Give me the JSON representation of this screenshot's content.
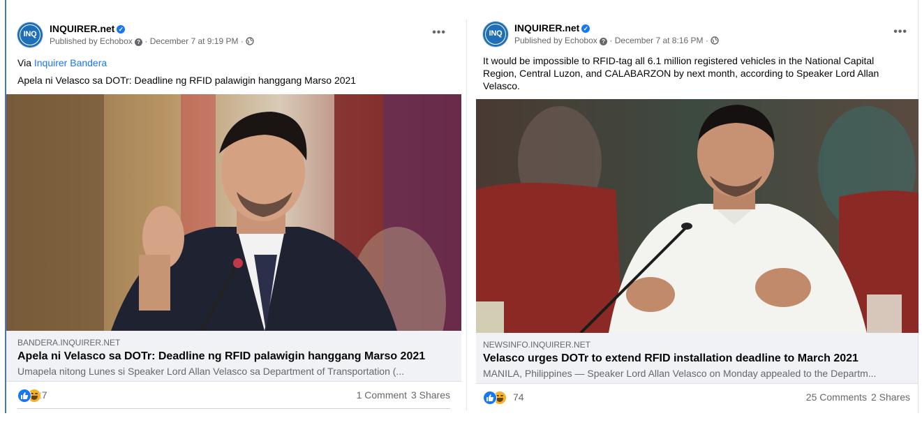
{
  "posts": [
    {
      "page_name": "INQUIRER.net",
      "avatar_text": "INQ",
      "published_by": "Published by Echobox",
      "timestamp": "December 7 at 9:19 PM",
      "via_prefix": "Via",
      "via_link": "Inquirer Bandera",
      "body": "Apela ni Velasco sa DOTr: Deadline ng RFID palawigin hanggang Marso 2021",
      "link_domain": "BANDERA.INQUIRER.NET",
      "link_title": "Apela ni Velasco sa DOTr: Deadline ng RFID palawigin hanggang Marso 2021",
      "link_description": "Umapela nitong Lunes si Speaker Lord Allan Velasco sa Department of Transportation (...",
      "reaction_count": "27",
      "comments": "1 Comment",
      "shares": "3 Shares"
    },
    {
      "page_name": "INQUIRER.net",
      "avatar_text": "INQ",
      "published_by": "Published by Echobox",
      "timestamp": "December 7 at 8:16 PM",
      "body": "It would be impossible to RFID-tag all 6.1 million registered vehicles in the National Capital Region, Central Luzon, and CALABARZON by next month, according to Speaker Lord Allan Velasco.",
      "link_domain": "NEWSINFO.INQUIRER.NET",
      "link_title": "Velasco urges DOTr to extend RFID installation deadline to March 2021",
      "link_description": "MANILA, Philippines — Speaker Lord Allan Velasco on Monday appealed to the Departm...",
      "reaction_count": "74",
      "comments": "25 Comments",
      "shares": "2 Shares"
    }
  ],
  "colors": {
    "accent": "#1877f2",
    "meta": "#65676b",
    "preview_bg": "#f0f2f5"
  },
  "icons": [
    "verified-badge-icon",
    "question-icon",
    "globe-icon",
    "more-options-icon",
    "like-reaction-icon",
    "haha-reaction-icon"
  ]
}
